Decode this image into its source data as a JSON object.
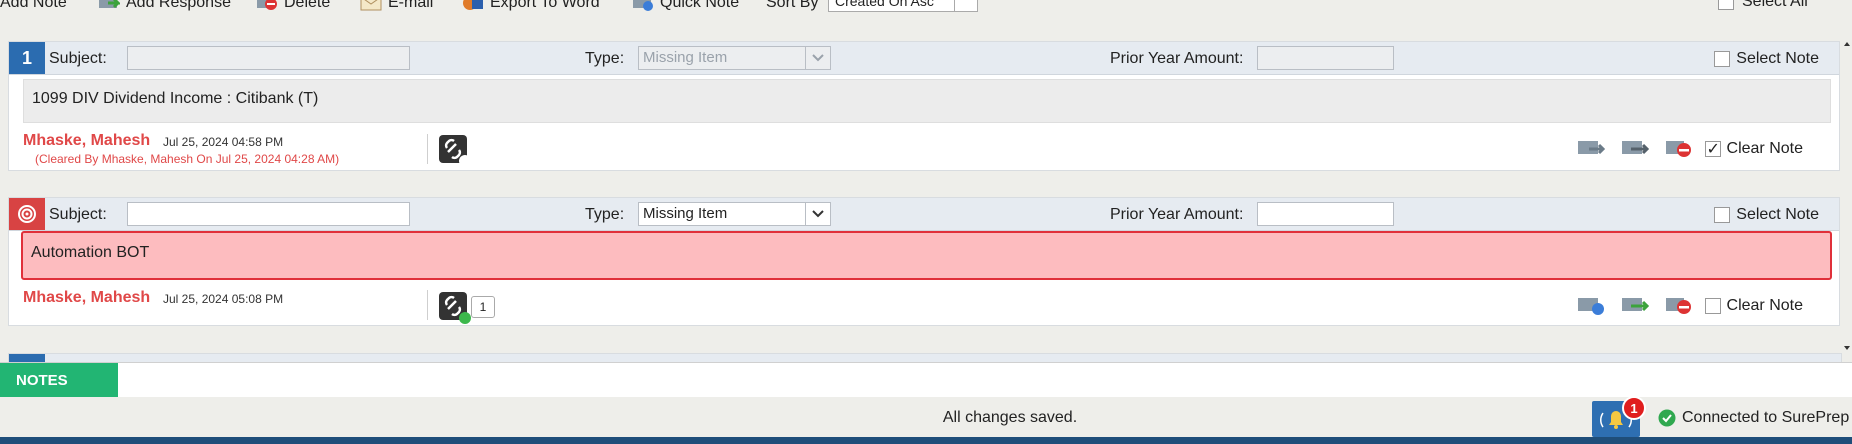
{
  "toolbar": {
    "add_note": "Add Note",
    "add_response": "Add Response",
    "delete": "Delete",
    "email": "E-mail",
    "export_word": "Export To Word",
    "quick_note": "Quick Note",
    "sort_by_label": "Sort By",
    "sort_value": "Created On Asc",
    "select_all": "Select All"
  },
  "notes": [
    {
      "number": "1",
      "subject_label": "Subject:",
      "subject_value": "",
      "type_label": "Type:",
      "type_value": "Missing Item",
      "prior_label": "Prior Year Amount:",
      "prior_value": "",
      "select_note_label": "Select Note",
      "body": "1099 DIV Dividend Income : Citibank (T)",
      "author": "Mhaske, Mahesh",
      "date": "Jul 25, 2024 04:58 PM",
      "cleared_text": "(Cleared By Mhaske, Mahesh On Jul 25, 2024 04:28 AM)",
      "clear_note_label": "Clear Note",
      "clear_checked": true
    },
    {
      "subject_label": "Subject:",
      "subject_value": "",
      "type_label": "Type:",
      "type_value": "Missing Item",
      "prior_label": "Prior Year Amount:",
      "prior_value": "",
      "select_note_label": "Select Note",
      "body": "Automation BOT",
      "author": "Mhaske, Mahesh",
      "date": "Jul 25, 2024 05:08 PM",
      "attachment_count": "1",
      "clear_note_label": "Clear Note",
      "clear_checked": false
    }
  ],
  "notes_tab": "NOTES",
  "status": {
    "message": "All changes saved.",
    "notification_count": "1",
    "connection": "Connected to SurePrep"
  },
  "colors": {
    "accent_blue": "#2b6cb0",
    "notes_green": "#22b573",
    "author_red": "#e04848",
    "active_note_bg": "#fdbcbf",
    "active_note_border": "#e0303a"
  }
}
